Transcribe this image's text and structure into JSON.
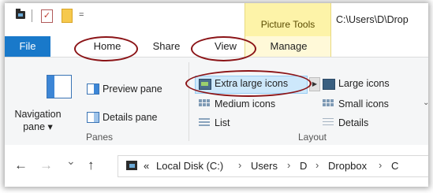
{
  "titlebar": {
    "picture_tools": "Picture Tools",
    "path": "C:\\Users\\D\\Drop",
    "qat_dropdown": "="
  },
  "tabs": [
    "File",
    "Home",
    "Share",
    "View",
    "Manage"
  ],
  "ribbon": {
    "panes": {
      "navigation_pane": "Navigation\npane",
      "navigation_pane_line1": "Navigation",
      "navigation_pane_line2": "pane ▾",
      "preview_pane": "Preview pane",
      "details_pane": "Details pane",
      "group_label": "Panes"
    },
    "layout": {
      "extra_large_icons": "Extra large icons",
      "large_icons": "Large icons",
      "medium_icons": "Medium icons",
      "small_icons": "Small icons",
      "list": "List",
      "details": "Details",
      "group_label": "Layout"
    }
  },
  "address": {
    "back": "←",
    "forward": "→",
    "recent": "⌄",
    "up": "↑",
    "overflow": "«",
    "crumbs": [
      "Local Disk (C:)",
      "Users",
      "D",
      "Dropbox",
      "C"
    ],
    "separator": "›"
  },
  "colors": {
    "file_tab": "#1979ca",
    "picture_tools": "#fdf3a8",
    "annotation_oval": "#8b1417",
    "selection": "#cde8fb"
  }
}
